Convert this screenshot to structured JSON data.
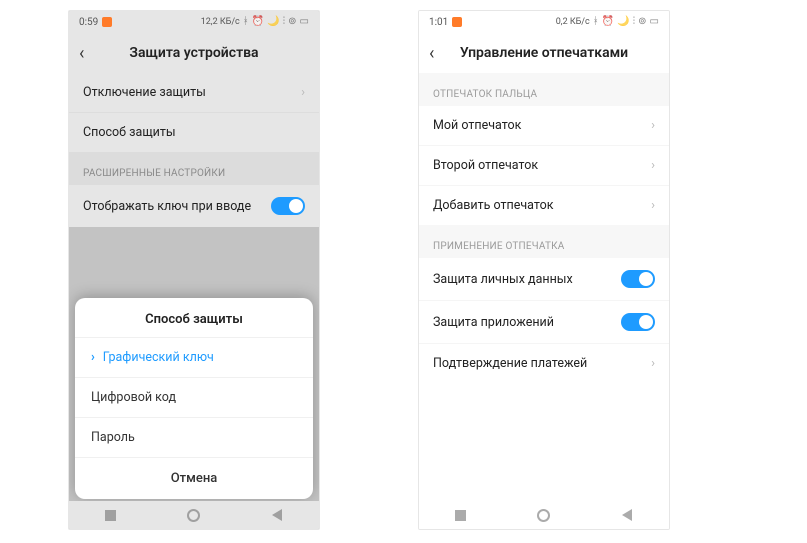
{
  "left": {
    "status": {
      "time": "0:59",
      "net": "12,2 КБ/с"
    },
    "header": {
      "title": "Защита устройства"
    },
    "rows": {
      "disable": "Отключение защиты",
      "method": "Способ защиты"
    },
    "section": "РАСШИРЕННЫЕ НАСТРОЙКИ",
    "show_key": "Отображать ключ при вводе",
    "sheet": {
      "title": "Способ защиты",
      "pattern": "Графический ключ",
      "pin": "Цифровой код",
      "password": "Пароль",
      "cancel": "Отмена"
    }
  },
  "right": {
    "status": {
      "time": "1:01",
      "net": "0,2 КБ/с"
    },
    "header": {
      "title": "Управление отпечатками"
    },
    "section1": "ОТПЕЧАТОК ПАЛЬЦА",
    "fp1": "Мой отпечаток",
    "fp2": "Второй отпечаток",
    "add": "Добавить отпечаток",
    "section2": "ПРИМЕНЕНИЕ ОТПЕЧАТКА",
    "priv": "Защита личных данных",
    "apps": "Защита приложений",
    "pay": "Подтверждение платежей"
  }
}
